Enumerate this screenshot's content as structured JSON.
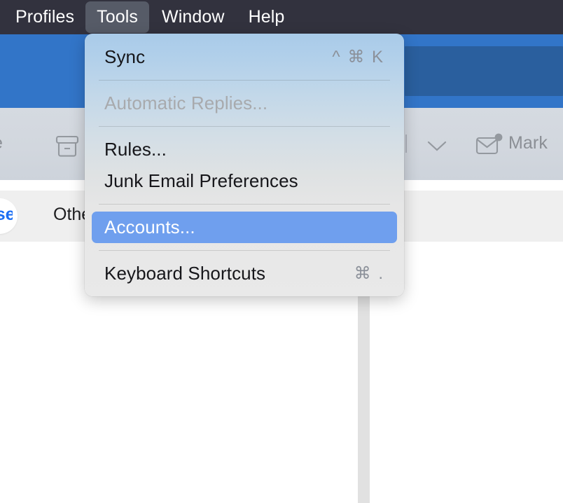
{
  "menubar": {
    "items": [
      {
        "label": "Profiles",
        "active": false
      },
      {
        "label": "Tools",
        "active": true
      },
      {
        "label": "Window",
        "active": false
      },
      {
        "label": "Help",
        "active": false
      }
    ]
  },
  "tools_menu": {
    "rows": [
      {
        "type": "item",
        "label": "Sync",
        "shortcut": "^ ⌘ K",
        "state": "enabled"
      },
      {
        "type": "separator"
      },
      {
        "type": "item",
        "label": "Automatic Replies...",
        "shortcut": "",
        "state": "disabled"
      },
      {
        "type": "separator"
      },
      {
        "type": "item",
        "label": "Rules...",
        "shortcut": "",
        "state": "enabled"
      },
      {
        "type": "item",
        "label": "Junk Email Preferences",
        "shortcut": "",
        "state": "enabled"
      },
      {
        "type": "separator"
      },
      {
        "type": "item",
        "label": "Accounts...",
        "shortcut": "",
        "state": "selected"
      },
      {
        "type": "separator"
      },
      {
        "type": "item",
        "label": "Keyboard Shortcuts",
        "shortcut": "⌘ .",
        "state": "enabled"
      }
    ]
  },
  "toolbar": {
    "truncated_label": "e",
    "archive_icon": "archive-box-icon",
    "chevron_icon": "chevron-down-icon",
    "envelope_icon": "envelope-unread-icon",
    "mark_label": "Mark"
  },
  "tabs": {
    "focused_label": "Focused",
    "other_label": "Other"
  },
  "colors": {
    "menubar_bg": "#32323e",
    "menubar_active_bg": "#565b67",
    "header_blue": "#3275c8",
    "search_blue": "#2a5f9e",
    "toolbar_gray": "#d3d8de",
    "tabbar_gray": "#efefef",
    "selection_blue": "#6f9fee",
    "accent_blue": "#1b6ef3",
    "splitter_gray": "#e1e1e1",
    "disabled_text": "#a8aaad",
    "shortcut_text": "#8b9099"
  }
}
